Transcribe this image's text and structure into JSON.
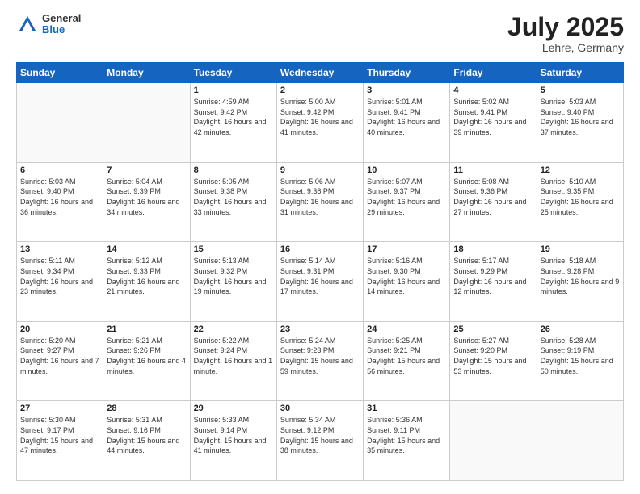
{
  "header": {
    "logo_general": "General",
    "logo_blue": "Blue",
    "title": "July 2025",
    "location": "Lehre, Germany"
  },
  "weekdays": [
    "Sunday",
    "Monday",
    "Tuesday",
    "Wednesday",
    "Thursday",
    "Friday",
    "Saturday"
  ],
  "weeks": [
    [
      {
        "day": "",
        "empty": true
      },
      {
        "day": "",
        "empty": true
      },
      {
        "day": "1",
        "sunrise": "Sunrise: 4:59 AM",
        "sunset": "Sunset: 9:42 PM",
        "daylight": "Daylight: 16 hours and 42 minutes."
      },
      {
        "day": "2",
        "sunrise": "Sunrise: 5:00 AM",
        "sunset": "Sunset: 9:42 PM",
        "daylight": "Daylight: 16 hours and 41 minutes."
      },
      {
        "day": "3",
        "sunrise": "Sunrise: 5:01 AM",
        "sunset": "Sunset: 9:41 PM",
        "daylight": "Daylight: 16 hours and 40 minutes."
      },
      {
        "day": "4",
        "sunrise": "Sunrise: 5:02 AM",
        "sunset": "Sunset: 9:41 PM",
        "daylight": "Daylight: 16 hours and 39 minutes."
      },
      {
        "day": "5",
        "sunrise": "Sunrise: 5:03 AM",
        "sunset": "Sunset: 9:40 PM",
        "daylight": "Daylight: 16 hours and 37 minutes."
      }
    ],
    [
      {
        "day": "6",
        "sunrise": "Sunrise: 5:03 AM",
        "sunset": "Sunset: 9:40 PM",
        "daylight": "Daylight: 16 hours and 36 minutes."
      },
      {
        "day": "7",
        "sunrise": "Sunrise: 5:04 AM",
        "sunset": "Sunset: 9:39 PM",
        "daylight": "Daylight: 16 hours and 34 minutes."
      },
      {
        "day": "8",
        "sunrise": "Sunrise: 5:05 AM",
        "sunset": "Sunset: 9:38 PM",
        "daylight": "Daylight: 16 hours and 33 minutes."
      },
      {
        "day": "9",
        "sunrise": "Sunrise: 5:06 AM",
        "sunset": "Sunset: 9:38 PM",
        "daylight": "Daylight: 16 hours and 31 minutes."
      },
      {
        "day": "10",
        "sunrise": "Sunrise: 5:07 AM",
        "sunset": "Sunset: 9:37 PM",
        "daylight": "Daylight: 16 hours and 29 minutes."
      },
      {
        "day": "11",
        "sunrise": "Sunrise: 5:08 AM",
        "sunset": "Sunset: 9:36 PM",
        "daylight": "Daylight: 16 hours and 27 minutes."
      },
      {
        "day": "12",
        "sunrise": "Sunrise: 5:10 AM",
        "sunset": "Sunset: 9:35 PM",
        "daylight": "Daylight: 16 hours and 25 minutes."
      }
    ],
    [
      {
        "day": "13",
        "sunrise": "Sunrise: 5:11 AM",
        "sunset": "Sunset: 9:34 PM",
        "daylight": "Daylight: 16 hours and 23 minutes."
      },
      {
        "day": "14",
        "sunrise": "Sunrise: 5:12 AM",
        "sunset": "Sunset: 9:33 PM",
        "daylight": "Daylight: 16 hours and 21 minutes."
      },
      {
        "day": "15",
        "sunrise": "Sunrise: 5:13 AM",
        "sunset": "Sunset: 9:32 PM",
        "daylight": "Daylight: 16 hours and 19 minutes."
      },
      {
        "day": "16",
        "sunrise": "Sunrise: 5:14 AM",
        "sunset": "Sunset: 9:31 PM",
        "daylight": "Daylight: 16 hours and 17 minutes."
      },
      {
        "day": "17",
        "sunrise": "Sunrise: 5:16 AM",
        "sunset": "Sunset: 9:30 PM",
        "daylight": "Daylight: 16 hours and 14 minutes."
      },
      {
        "day": "18",
        "sunrise": "Sunrise: 5:17 AM",
        "sunset": "Sunset: 9:29 PM",
        "daylight": "Daylight: 16 hours and 12 minutes."
      },
      {
        "day": "19",
        "sunrise": "Sunrise: 5:18 AM",
        "sunset": "Sunset: 9:28 PM",
        "daylight": "Daylight: 16 hours and 9 minutes."
      }
    ],
    [
      {
        "day": "20",
        "sunrise": "Sunrise: 5:20 AM",
        "sunset": "Sunset: 9:27 PM",
        "daylight": "Daylight: 16 hours and 7 minutes."
      },
      {
        "day": "21",
        "sunrise": "Sunrise: 5:21 AM",
        "sunset": "Sunset: 9:26 PM",
        "daylight": "Daylight: 16 hours and 4 minutes."
      },
      {
        "day": "22",
        "sunrise": "Sunrise: 5:22 AM",
        "sunset": "Sunset: 9:24 PM",
        "daylight": "Daylight: 16 hours and 1 minute."
      },
      {
        "day": "23",
        "sunrise": "Sunrise: 5:24 AM",
        "sunset": "Sunset: 9:23 PM",
        "daylight": "Daylight: 15 hours and 59 minutes."
      },
      {
        "day": "24",
        "sunrise": "Sunrise: 5:25 AM",
        "sunset": "Sunset: 9:21 PM",
        "daylight": "Daylight: 15 hours and 56 minutes."
      },
      {
        "day": "25",
        "sunrise": "Sunrise: 5:27 AM",
        "sunset": "Sunset: 9:20 PM",
        "daylight": "Daylight: 15 hours and 53 minutes."
      },
      {
        "day": "26",
        "sunrise": "Sunrise: 5:28 AM",
        "sunset": "Sunset: 9:19 PM",
        "daylight": "Daylight: 15 hours and 50 minutes."
      }
    ],
    [
      {
        "day": "27",
        "sunrise": "Sunrise: 5:30 AM",
        "sunset": "Sunset: 9:17 PM",
        "daylight": "Daylight: 15 hours and 47 minutes."
      },
      {
        "day": "28",
        "sunrise": "Sunrise: 5:31 AM",
        "sunset": "Sunset: 9:16 PM",
        "daylight": "Daylight: 15 hours and 44 minutes."
      },
      {
        "day": "29",
        "sunrise": "Sunrise: 5:33 AM",
        "sunset": "Sunset: 9:14 PM",
        "daylight": "Daylight: 15 hours and 41 minutes."
      },
      {
        "day": "30",
        "sunrise": "Sunrise: 5:34 AM",
        "sunset": "Sunset: 9:12 PM",
        "daylight": "Daylight: 15 hours and 38 minutes."
      },
      {
        "day": "31",
        "sunrise": "Sunrise: 5:36 AM",
        "sunset": "Sunset: 9:11 PM",
        "daylight": "Daylight: 15 hours and 35 minutes."
      },
      {
        "day": "",
        "empty": true
      },
      {
        "day": "",
        "empty": true
      }
    ]
  ]
}
